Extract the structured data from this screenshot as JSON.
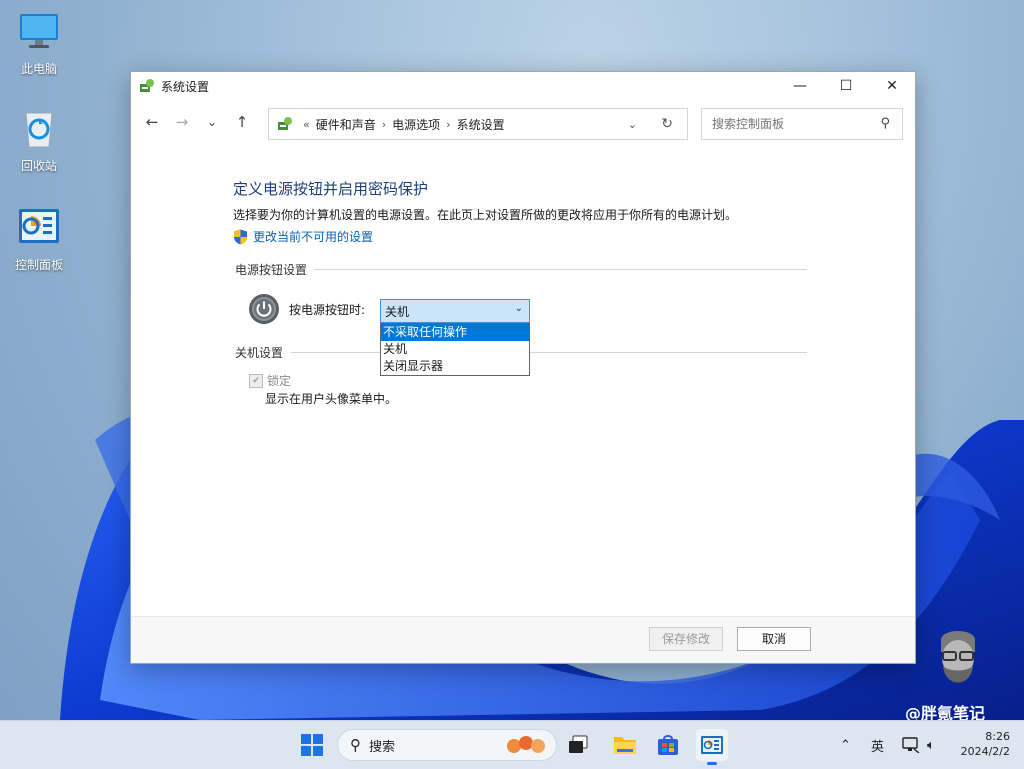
{
  "desktop": {
    "icons": [
      {
        "label": "此电脑"
      },
      {
        "label": "回收站"
      },
      {
        "label": "控制面板"
      }
    ]
  },
  "window": {
    "title": "系统设置",
    "controls": {
      "minimize": "—",
      "maximize": "☐",
      "close": "✕"
    }
  },
  "nav": {
    "back": "←",
    "forward": "→",
    "recent": "⌄",
    "up": "↑",
    "breadcrumb": {
      "overflow": "«",
      "items": [
        "硬件和声音",
        "电源选项",
        "系统设置"
      ]
    },
    "search_placeholder": "搜索控制面板"
  },
  "content": {
    "heading": "定义电源按钮并启用密码保护",
    "description": "选择要为你的计算机设置的电源设置。在此页上对设置所做的更改将应用于你所有的电源计划。",
    "change_link": "更改当前不可用的设置",
    "power_section": "电源按钮设置",
    "power_label": "按电源按钮时:",
    "power_select_value": "关机",
    "power_options": [
      "不采取任何操作",
      "关机",
      "关闭显示器"
    ],
    "power_options_selected_index": 0,
    "shutdown_section": "关机设置",
    "lock_label": "锁定",
    "lock_checked": true,
    "lock_enabled": false,
    "lock_desc": "显示在用户头像菜单中。"
  },
  "footer": {
    "save": "保存修改",
    "cancel": "取消"
  },
  "taskbar": {
    "search_text": "搜索",
    "ime": "英",
    "time": "8:26",
    "date": "2024/2/2"
  },
  "watermark": "@胖氪笔记",
  "colors": {
    "link": "#0a5fb4",
    "heading": "#1e3f7c",
    "selected": "#0078d7",
    "select_bg": "#cce4f7"
  }
}
